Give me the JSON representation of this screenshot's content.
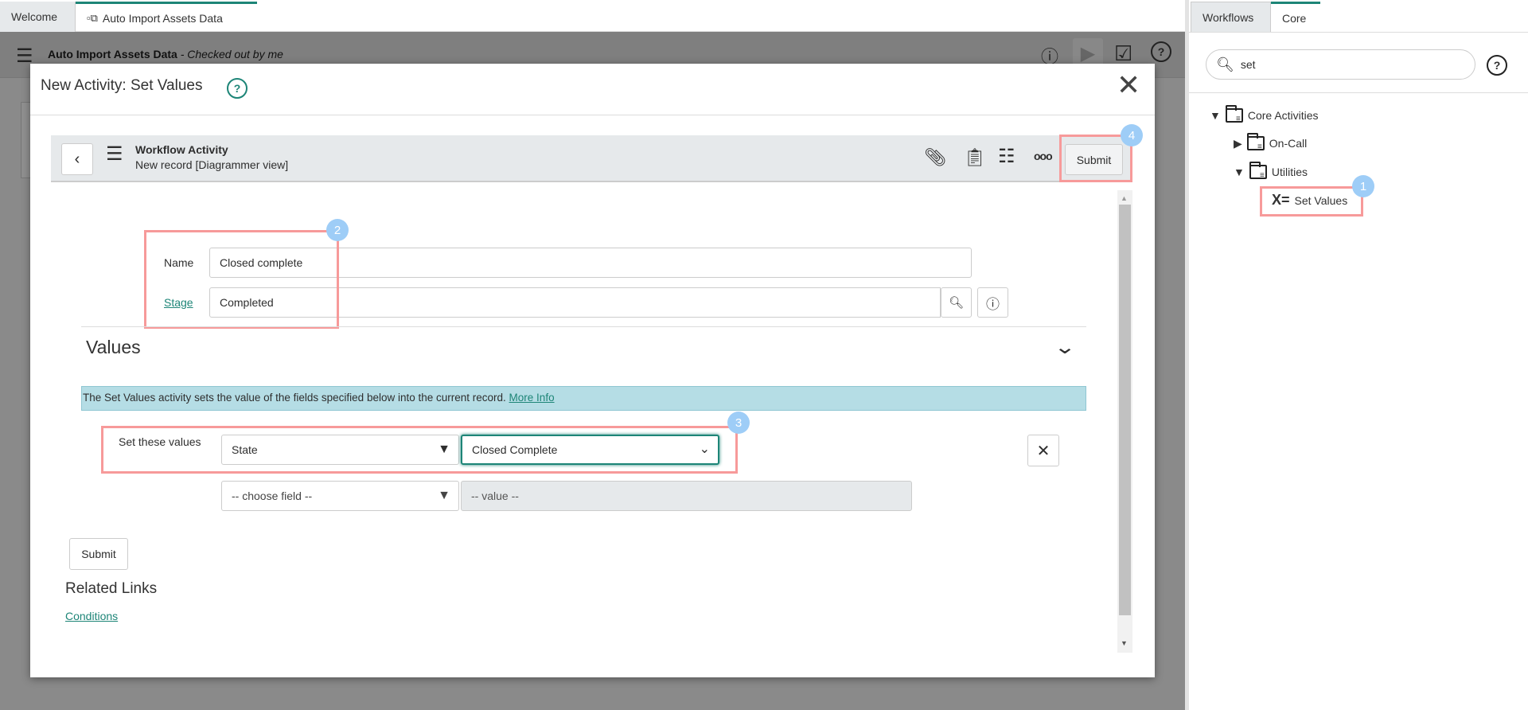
{
  "tabs": {
    "welcome": "Welcome",
    "workflow": "Auto Import Assets Data"
  },
  "background_header": {
    "title": "Auto Import Assets Data",
    "status": "- Checked out by me"
  },
  "modal": {
    "title": "New Activity: Set Values",
    "form_header": {
      "title": "Workflow Activity",
      "subtitle": "New record [Diagrammer view]",
      "submit": "Submit"
    },
    "fields": {
      "name_label": "Name",
      "name_value": "Closed complete",
      "stage_label": "Stage",
      "stage_value": "Completed"
    },
    "values_section": {
      "heading": "Values",
      "info_text": "The Set Values activity sets the value of the fields specified below into the current record.",
      "more_info": "More Info",
      "set_label": "Set these values",
      "field_1": "State",
      "value_1": "Closed Complete",
      "field_2_placeholder": "-- choose field --",
      "value_2_placeholder": "-- value --"
    },
    "submit": "Submit",
    "related_links": {
      "heading": "Related Links",
      "conditions": "Conditions"
    }
  },
  "right_panel": {
    "tabs": [
      "Workflows",
      "Core"
    ],
    "search_value": "set",
    "tree": {
      "core_activities": "Core Activities",
      "on_call": "On-Call",
      "utilities": "Utilities",
      "set_values": "Set Values",
      "set_values_icon": "X="
    }
  },
  "annotations": [
    "1",
    "2",
    "3",
    "4"
  ],
  "colors": {
    "accent": "#1d8577",
    "highlight": "#f79a9a",
    "badge": "#9ecdf7",
    "info_banner": "#b5dde5"
  }
}
